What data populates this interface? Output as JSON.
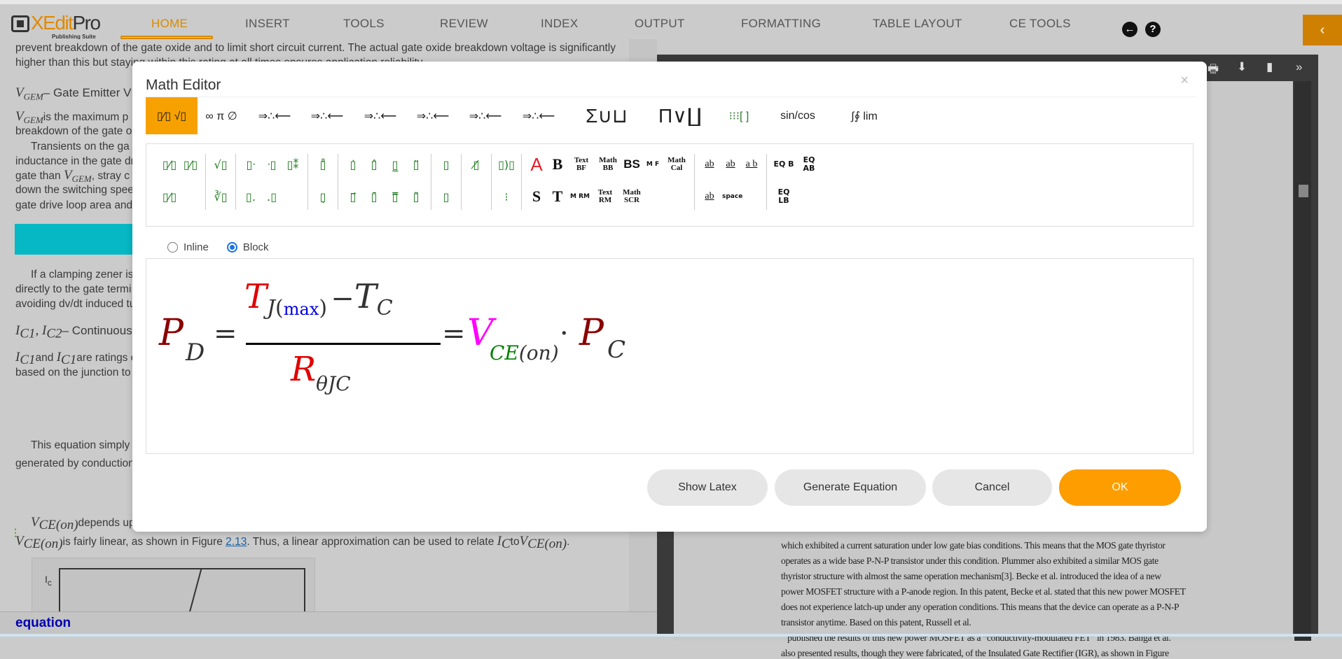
{
  "app": {
    "logo_main": "XEdit",
    "logo_pro": "Pro",
    "logo_sub": "Publishing Suite",
    "accent": "#d98a00"
  },
  "nav": [
    "HOME",
    "INSERT",
    "TOOLS",
    "REVIEW",
    "INDEX",
    "OUTPUT",
    "FORMATTING",
    "TABLE LAYOUT",
    "CE TOOLS"
  ],
  "nav_active": "HOME",
  "header_icons": {
    "back": "←",
    "help": "?",
    "collapse": "‹"
  },
  "document": {
    "lines": [
      "prevent breakdown of the gate oxide and to limit short circuit current. The actual gate oxide breakdown voltage is significantly",
      "higher than this but staying within this rating at all times ensures application reliability."
    ],
    "vgem_heading_sym": "V",
    "vgem_sub": "GEM",
    "vgem_heading_text": "– Gate Emitter V",
    "vgem_para1": "is the maximum p",
    "vgem_para2": "breakdown of the gate ox",
    "trans1": "Transients on the ga",
    "trans2": "inductance in the gate dr",
    "trans3a": "gate than ",
    "trans3b": ", stray c",
    "trans4": "down the switching spee",
    "trans5": "gate drive loop area and",
    "clamp1": "If a clamping zener is",
    "clamp2": "directly to the gate termi",
    "clamp3": "avoiding dv/dt induced tu",
    "ic_sym": "I",
    "ic1_sub": "C1",
    "ic2_sub": "C2",
    "ic_heading_text": "– Continuous",
    "ic_para_and": "and ",
    "ic_para_rest": "are ratings of",
    "ic_para2": "based on the junction to c",
    "eq1": "This equation simply",
    "eq2": "generated by conduction",
    "vce_sym": "V",
    "vce_sub": "CE(on)",
    "vce1": "depends upon",
    "vce2a": "is fairly linear, as shown in Figure ",
    "vce2_link": "2.13",
    "vce2b": ". Thus, a linear approximation can be used to relate ",
    "vce2_ic_sub": "C",
    "vce2_to": "to",
    "figure_label": "I",
    "figure_label_sub": "c"
  },
  "status": {
    "text": "equation"
  },
  "pdf": {
    "lines": [
      "which exhibited a current saturation under low gate bias conditions. This means that the MOS gate thyristor",
      "operates as a wide base P-N-P transistor under this condition. Plummer also exhibited a similar MOS gate",
      "thyristor structure with almost the same operation mechanism[3]. Becke et al. introduced the idea of a new",
      "power MOSFET structure with a P-anode region. In this patent, Becke et al. stated that this new power MOSFET",
      "does not experience latch-up under any operation conditions. This means that the device can operate as a P-N-P",
      "transistor anytime. Based on this patent, Russell et al.",
      "   published the results of this new power MOSFET as a “conductivity-modulated FET” in 1983. Baliga et al.",
      "also presented results, though they were fabricated, of the Insulated Gate Rectifier (IGR), as shown in Figure"
    ],
    "toolbar_icons": [
      "print-icon",
      "download-icon",
      "bookmark-icon",
      "more-icon"
    ]
  },
  "modal": {
    "title": "Math Editor",
    "close": "×",
    "toolbar": [
      {
        "label": "▯⁄▯ √▯",
        "name": "fraction-root-tab",
        "active": true
      },
      {
        "label": "∞ π ∅",
        "name": "symbols-tab"
      },
      {
        "label": "⇒∴⟵",
        "name": "arrows-tab-1"
      },
      {
        "label": "⇒∴⟵",
        "name": "arrows-tab-2"
      },
      {
        "label": "⇒∴⟵",
        "name": "arrows-tab-3"
      },
      {
        "label": "⇒∴⟵",
        "name": "arrows-tab-4"
      },
      {
        "label": "⇒∴⟵",
        "name": "arrows-tab-5"
      },
      {
        "label": "⇒∴⟵",
        "name": "arrows-tab-6"
      },
      {
        "label": "Σ∪⊔",
        "name": "sum-union-tab"
      },
      {
        "label": "Π∨∐",
        "name": "product-tab"
      },
      {
        "label": "⁝⁝⁝[ ]",
        "name": "matrix-tab"
      },
      {
        "label": "sin/cos",
        "name": "trig-tab"
      },
      {
        "label": "∫∮ lim",
        "name": "calculus-tab"
      }
    ],
    "palette": [
      {
        "r1": [
          {
            "t": "▯⁄▯"
          },
          {
            "t": "▯⁄▯"
          }
        ],
        "r2": [
          {
            "t": "▯⁄▯"
          }
        ]
      },
      {
        "r1": [
          {
            "t": "√▯"
          }
        ],
        "r2": [
          {
            "t": "∛▯"
          }
        ]
      },
      {
        "r1": [
          {
            "t": "▯ᐧ"
          },
          {
            "t": "ᐧ▯"
          },
          {
            "t": "▯⁑"
          }
        ],
        "r2": [
          {
            "t": "▯․"
          },
          {
            "t": "․▯"
          }
        ]
      },
      {
        "r1": [
          {
            "t": "▯̊"
          }
        ],
        "r2": [
          {
            "t": "▯̣"
          }
        ]
      },
      {
        "r1": [
          {
            "t": "▯̇"
          },
          {
            "t": "▯̂"
          },
          {
            "t": "▯̲"
          },
          {
            "t": "▯̈"
          }
        ],
        "r2": [
          {
            "t": "▯⃗"
          },
          {
            "t": "▯̄"
          },
          {
            "t": "▯̿"
          },
          {
            "t": "▯̃"
          }
        ]
      },
      {
        "r1": [
          {
            "t": "▯"
          }
        ],
        "r2": [
          {
            "t": "▯"
          }
        ]
      },
      {
        "r1": [
          {
            "t": "▯̸"
          }
        ],
        "r2": []
      },
      {
        "r1": [
          {
            "t": "▯)▯"
          }
        ],
        "r2": [
          {
            "t": "⁝"
          }
        ]
      },
      {
        "r1": [
          {
            "t": "A",
            "c": "red"
          },
          {
            "t": "B",
            "c": "big"
          },
          {
            "t": "Text BF",
            "c": "txt"
          },
          {
            "t": "Math BB",
            "c": "txt"
          },
          {
            "t": "BS",
            "c": "bs"
          },
          {
            "t": "M F",
            "c": "sm"
          },
          {
            "t": "Math Cal",
            "c": "txt"
          }
        ],
        "r2": [
          {
            "t": "S",
            "c": "big"
          },
          {
            "t": "T",
            "c": "big"
          },
          {
            "t": "M RM",
            "c": "sm"
          },
          {
            "t": "Text RM",
            "c": "txt"
          },
          {
            "t": "Math SCR",
            "c": "txt"
          }
        ]
      },
      {
        "r1": [
          {
            "t": "ab",
            "c": "ul"
          },
          {
            "t": "ab",
            "c": "ul"
          },
          {
            "t": "a b",
            "c": "ul"
          }
        ],
        "r2": [
          {
            "t": "ab",
            "c": "ul"
          },
          {
            "t": "space",
            "c": "sm"
          }
        ]
      },
      {
        "r1": [
          {
            "t": "EQ B",
            "c": "eq"
          },
          {
            "t": "EQ AB",
            "c": "eq"
          }
        ],
        "r2": [
          {
            "t": "EQ LB",
            "c": "eq"
          }
        ]
      }
    ],
    "mode": {
      "inline": "Inline",
      "block": "Block",
      "selected": "Block"
    },
    "equation": {
      "lhs": "P",
      "lhs_sub": "D",
      "eq": "=",
      "num_T": "T",
      "num_J": "J",
      "num_open": "(",
      "num_max": "max",
      "num_close": ")",
      "num_minus": "−",
      "num_T2": "T",
      "num_C": "C",
      "den_R": "R",
      "den_sub": "θJC",
      "eq2": "=",
      "V": "V",
      "V_sub_CE": "CE",
      "V_sub_on": "(on)",
      "dot": "·",
      "P2": "P",
      "P2_sub": "C",
      "colors": {
        "P": "#8b0000",
        "T": "#e00000",
        "max": "#0000e0",
        "R": "#e00000",
        "V": "#ff00ff",
        "CE": "#008000"
      }
    },
    "buttons": {
      "show_latex": "Show Latex",
      "generate": "Generate Equation",
      "cancel": "Cancel",
      "ok": "OK"
    }
  }
}
